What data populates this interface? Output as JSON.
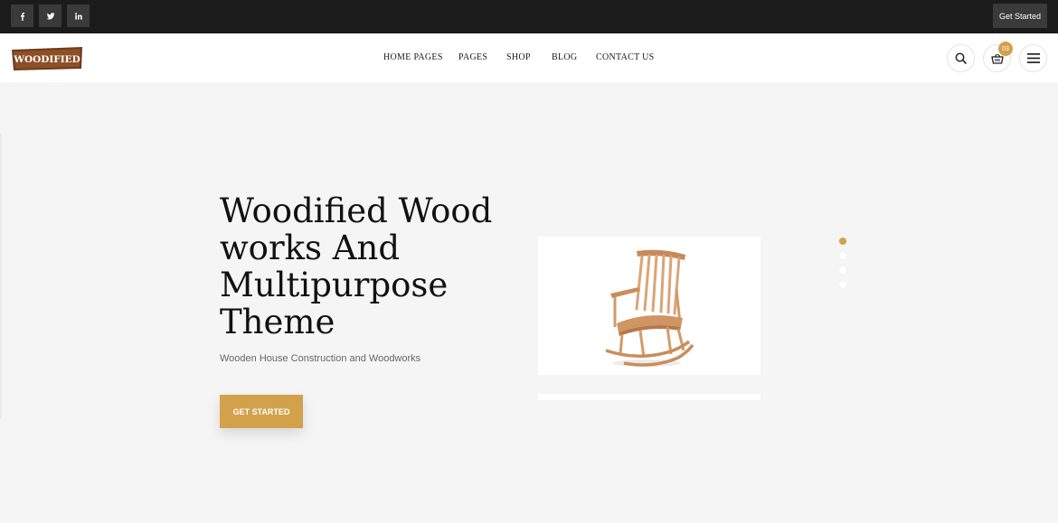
{
  "topbar": {
    "social": [
      {
        "name": "facebook-icon",
        "glyph": "f"
      },
      {
        "name": "twitter-icon",
        "glyph": "t"
      },
      {
        "name": "linkedin-icon",
        "glyph": "in"
      }
    ],
    "cta_label": "Get Started"
  },
  "header": {
    "logo_text": "WOODIFIED",
    "nav": [
      "HOME PAGES",
      "PAGES",
      "SHOP",
      "BLOG",
      "CONTACT US"
    ],
    "cart_count": "03"
  },
  "hero": {
    "title": "Woodified Wood works And Multipurpose Theme",
    "subtitle": "Wooden House Construction and Woodworks",
    "button_label": "GET STARTED"
  },
  "slider": {
    "active_index": 0,
    "total": 4
  },
  "colors": {
    "accent": "#d3a14c",
    "topbar": "#1b1b1b"
  }
}
